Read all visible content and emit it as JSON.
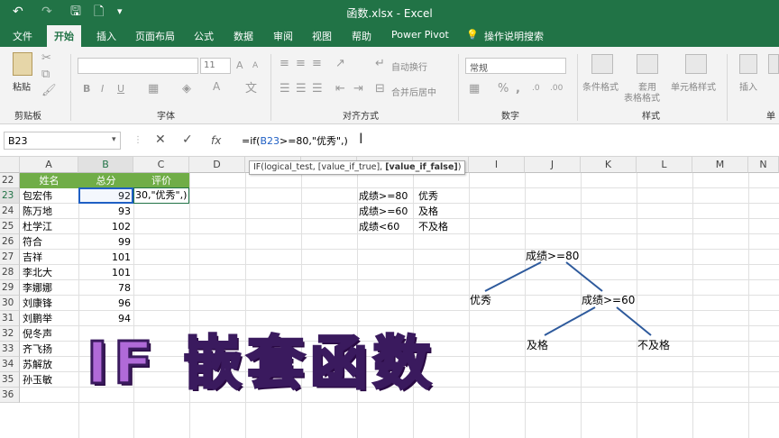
{
  "window": {
    "title": "函数.xlsx  -  Excel"
  },
  "quick_access": {
    "undo": "↶",
    "redo": "↷",
    "save": "🖫",
    "new": "🗋",
    "more": "▾"
  },
  "tabs": [
    "文件",
    "开始",
    "插入",
    "页面布局",
    "公式",
    "数据",
    "审阅",
    "视图",
    "帮助",
    "Power Pivot",
    "操作说明搜索"
  ],
  "ribbon": {
    "groups": [
      "剪贴板",
      "字体",
      "对齐方式",
      "数字",
      "样式"
    ],
    "paste_label": "粘贴",
    "font_size": "11",
    "wrap_text": "自动换行",
    "merge_center": "合并后居中",
    "number_format": "常规",
    "conditional_format": "条件格式",
    "format_table_line1": "套用",
    "format_table_line2": "表格格式",
    "cell_styles": "单元格样式",
    "insert": "插入",
    "cut_group_partial": "单"
  },
  "formula_bar": {
    "name_box": "B23",
    "formula_prefix": "=if(",
    "formula_ref": "B23",
    "formula_suffix": ">=80,\"优秀\",)"
  },
  "tooltip": {
    "prefix": "IF(logical_test, [value_if_true], ",
    "bold": "[value_if_false]",
    "suffix": ")"
  },
  "columns": [
    "A",
    "B",
    "C",
    "D",
    "E",
    "F",
    "G",
    "H",
    "I",
    "J",
    "K",
    "L",
    "M",
    "N"
  ],
  "rows": [
    "22",
    "23",
    "24",
    "25",
    "26",
    "27",
    "28",
    "29",
    "30",
    "31",
    "32",
    "33",
    "34",
    "35",
    "36"
  ],
  "table": {
    "headers": [
      "姓名",
      "总分",
      "评价"
    ],
    "names": [
      "包宏伟",
      "陈万地",
      "杜学江",
      "符合",
      "吉祥",
      "李北大",
      "李娜娜",
      "刘康锋",
      "刘鹏举",
      "倪冬声",
      "齐飞扬",
      "苏解放",
      "孙玉敏"
    ],
    "scores": [
      "92",
      "93",
      "102",
      "99",
      "101",
      "101",
      "78",
      "96",
      "94",
      "",
      "",
      "",
      ""
    ]
  },
  "edit_cell_text": "30,\"优秀\",)",
  "criteria": [
    {
      "cond": "成绩>=80",
      "result": "优秀"
    },
    {
      "cond": "成绩>=60",
      "result": "及格"
    },
    {
      "cond": "成绩<60",
      "result": "不及格"
    }
  ],
  "tree": {
    "root": "成绩>=80",
    "left": "优秀",
    "mid": "成绩>=60",
    "pass": "及格",
    "fail": "不及格"
  },
  "overlay_title": "IF 嵌套函数",
  "colors": {
    "excel_green": "#217346",
    "header_green": "#70ad47",
    "overlay_purple": "#b06ad8"
  }
}
